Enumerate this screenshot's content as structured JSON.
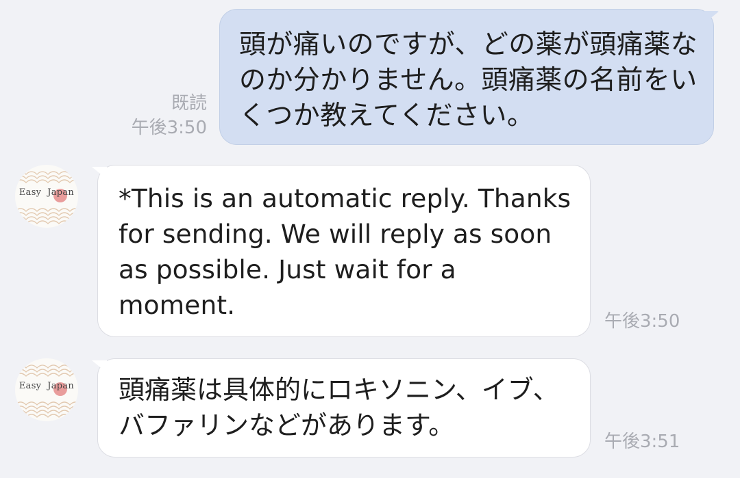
{
  "messages": [
    {
      "direction": "outgoing",
      "text": "頭が痛いのですが、どの薬が頭痛薬なのか分かりません。頭痛薬の名前をいくつか教えてください。",
      "read_label": "既読",
      "time": "午後3:50"
    },
    {
      "direction": "incoming",
      "sender_logo": "Easy  Japan",
      "text": "*This is an automatic reply. Thanks for sending. We will reply as soon as possible. Just wait for a moment.",
      "time": "午後3:50"
    },
    {
      "direction": "incoming",
      "sender_logo": "Easy  Japan",
      "text": "頭痛薬は具体的にロキソニン、イブ、バファリンなどがあります。",
      "time": "午後3:51"
    }
  ],
  "colors": {
    "background": "#f1f2f6",
    "outgoing_bubble": "#d3def2",
    "incoming_bubble": "#ffffff",
    "meta_text": "#a9abb2",
    "logo_accent": "#e58c8c"
  }
}
